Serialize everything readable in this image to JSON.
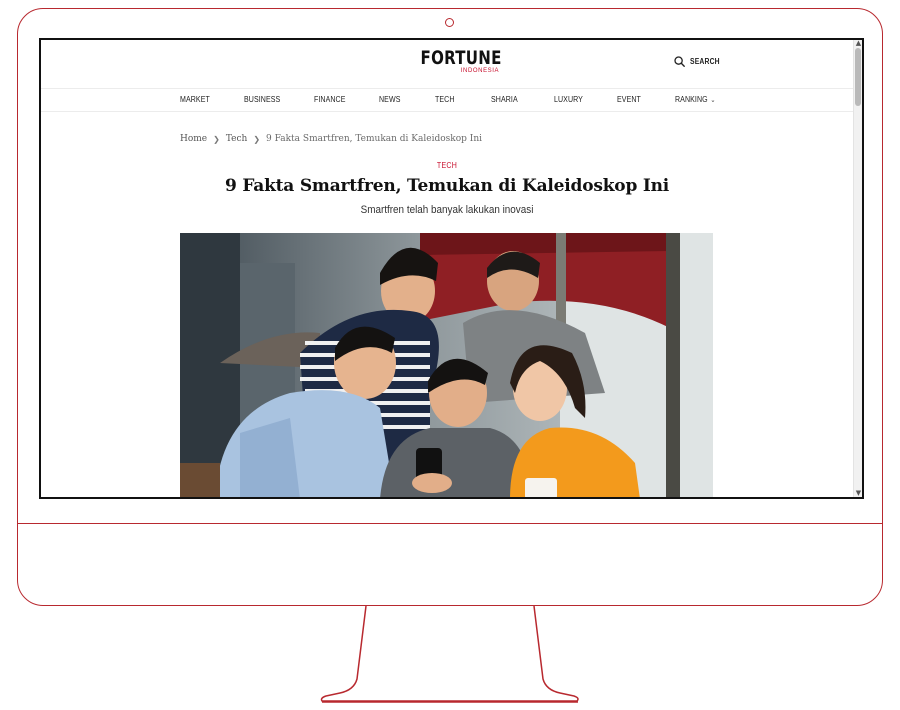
{
  "site": {
    "logo_main": "FORTUNE",
    "logo_sub": "INDONESIA",
    "search_label": "SEARCH",
    "search_icon": "search-icon"
  },
  "nav": {
    "items": [
      "MARKET",
      "BUSINESS",
      "FINANCE",
      "NEWS",
      "TECH",
      "SHARIA",
      "LUXURY",
      "EVENT",
      "RANKING"
    ],
    "dropdown_icon": "chevron-down-icon"
  },
  "breadcrumb": {
    "home": "Home",
    "section": "Tech",
    "current": "9 Fakta Smartfren, Temukan di Kaleidoskop Ini",
    "separator_icon": "chevron-right-icon"
  },
  "article": {
    "category": "TECH",
    "title": "9 Fakta Smartfren, Temukan di Kaleidoskop Ini",
    "subtitle": "Smartfren telah banyak lakukan inovasi"
  },
  "colors": {
    "accent": "#c8102e",
    "frame": "#b8292f",
    "text": "#111111"
  }
}
